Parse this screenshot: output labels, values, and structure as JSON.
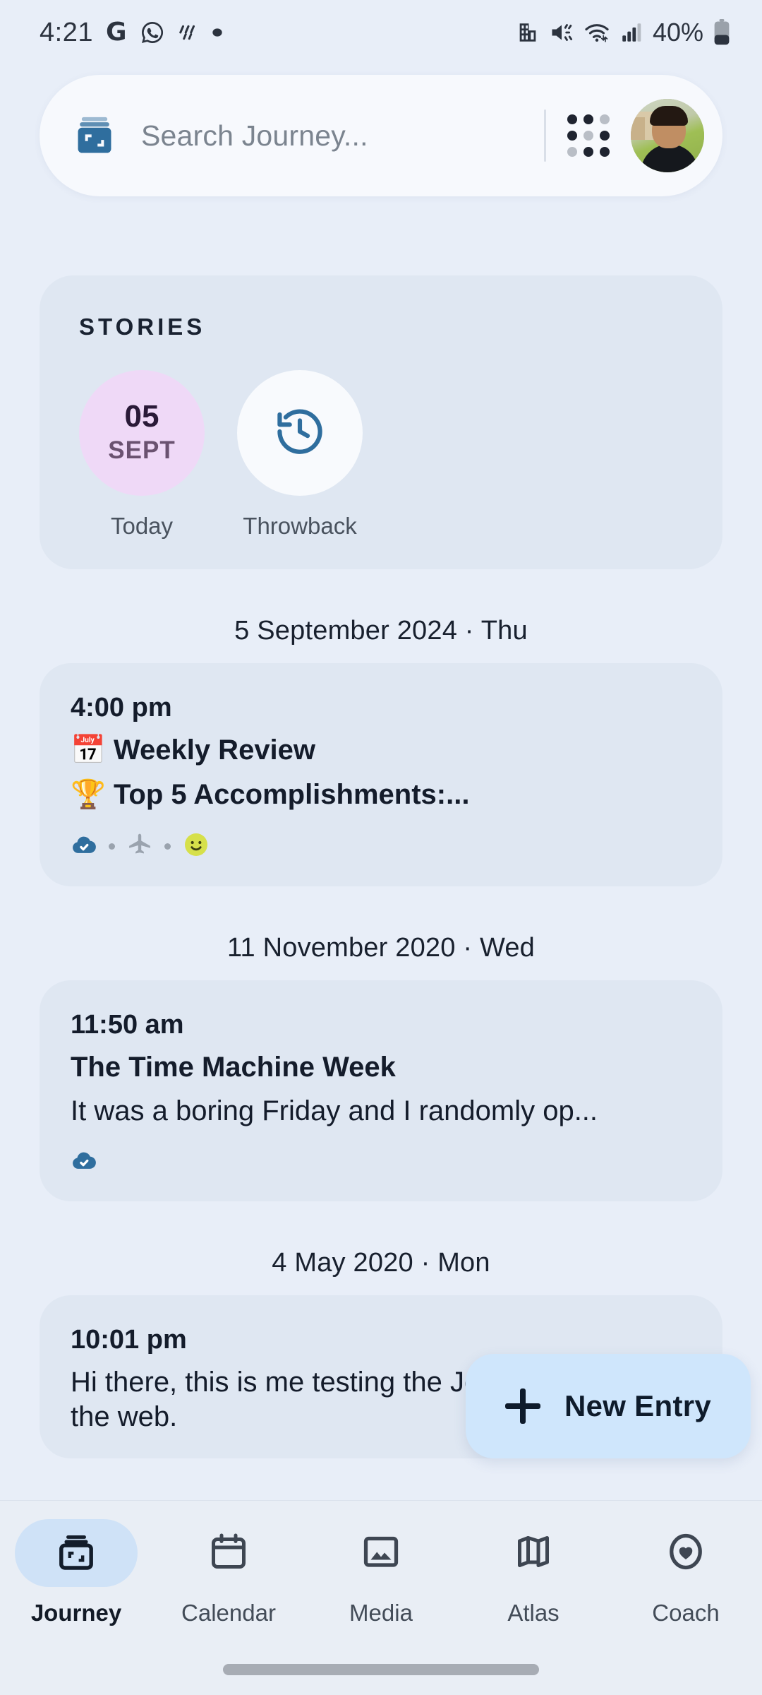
{
  "status_bar": {
    "time": "4:21",
    "left_icons": [
      "google-icon",
      "whatsapp-icon",
      "rain-icon",
      "dot-icon"
    ],
    "right_icons": [
      "building-icon",
      "mute-icon",
      "wifi-icon",
      "signal-icon"
    ],
    "battery_percent": "40%"
  },
  "search": {
    "placeholder": "Search Journey...",
    "logo_icon": "journey-logo-icon",
    "grid_icon": "apps-grid-icon",
    "avatar_icon": "user-avatar"
  },
  "stories": {
    "title": "STORIES",
    "items": [
      {
        "day": "05",
        "month": "SEPT",
        "label": "Today",
        "style": "today"
      },
      {
        "icon": "history-clock-icon",
        "label": "Throwback",
        "style": "white"
      }
    ]
  },
  "timeline": [
    {
      "date_header": "5 September 2024 · Thu",
      "time": "4:00 pm",
      "lines": [
        {
          "emoji": "📅",
          "text": "Weekly Review",
          "bold": true
        },
        {
          "emoji": "🏆",
          "text": "Top 5 Accomplishments:...",
          "bold": true
        }
      ],
      "meta": [
        "cloud-synced-icon",
        "airplane-icon",
        "mood-smiley-icon"
      ]
    },
    {
      "date_header": "11 November 2020 · Wed",
      "time": "11:50 am",
      "lines": [
        {
          "emoji": "",
          "text": "The Time Machine Week",
          "bold": true
        },
        {
          "emoji": "",
          "text": "It was a boring Friday and I randomly op...",
          "bold": false
        }
      ],
      "meta": [
        "cloud-synced-icon"
      ]
    },
    {
      "date_header": "4 May 2020 · Mon",
      "time": "10:01 pm",
      "lines": [
        {
          "emoji": "",
          "text": "Hi there, this is me testing the Journey app on the web.",
          "bold": false
        }
      ],
      "meta": []
    }
  ],
  "fab": {
    "label": "New Entry",
    "icon": "plus-icon",
    "background": "#cfe6fc"
  },
  "bottom_nav": {
    "items": [
      {
        "label": "Journey",
        "icon": "journey-box-icon",
        "active": true
      },
      {
        "label": "Calendar",
        "icon": "calendar-icon",
        "active": false
      },
      {
        "label": "Media",
        "icon": "image-icon",
        "active": false
      },
      {
        "label": "Atlas",
        "icon": "map-icon",
        "active": false
      },
      {
        "label": "Coach",
        "icon": "heart-circle-icon",
        "active": false
      }
    ]
  },
  "colors": {
    "page_background": "#e8eef8",
    "card_background": "#dfe7f2",
    "search_background": "#f7f9fd",
    "accent_blue": "#cfe6fc",
    "brand_blue": "#2f6e9e",
    "today_purple": "#efd9f7",
    "text_primary": "#141c2b",
    "text_muted": "#49525e"
  }
}
